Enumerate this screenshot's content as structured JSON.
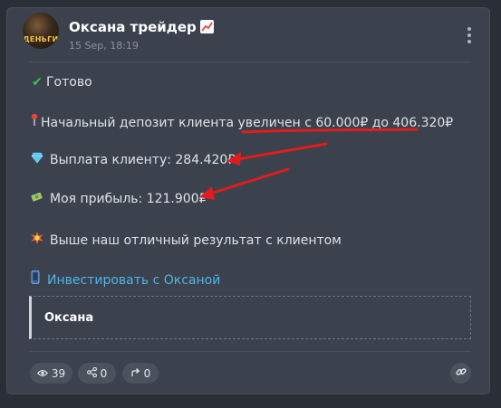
{
  "post": {
    "author": "Оксана трейдер",
    "author_emoji": "chart-increasing-icon",
    "avatar_text": "ДЕНЬГИ",
    "timestamp": "15 Sep, 18:19"
  },
  "lines": [
    {
      "icon": "check-mark-icon",
      "glyph": "✔",
      "color": "#3fbf4a",
      "text": "Готово"
    },
    {
      "icon": "pushpin-icon",
      "glyph": "📍",
      "color": "#e0453a",
      "text": "Начальный депозит клиента увеличен с 60.000₽ до 406.320₽"
    },
    {
      "icon": "gem-icon",
      "glyph": "💎",
      "color": "#5cc6f0",
      "text": "Выплата клиенту: 284.420₽"
    },
    {
      "icon": "money-icon",
      "glyph": "💸",
      "color": "#9bc46a",
      "text": "Моя прибыль: 121.900₽"
    },
    {
      "icon": "collision-icon",
      "glyph": "💥",
      "color": "#ff6a2a",
      "text": "Выше наш отличный результат с клиентом"
    }
  ],
  "cta": {
    "icon": "mobile-phone-icon",
    "glyph": "📱",
    "label": "Инвестировать с Оксаной"
  },
  "quote": {
    "text": "Оксана"
  },
  "footer": {
    "views": "39",
    "shares": "0",
    "forwards": "0"
  },
  "annotation_color": "#e01c1c"
}
